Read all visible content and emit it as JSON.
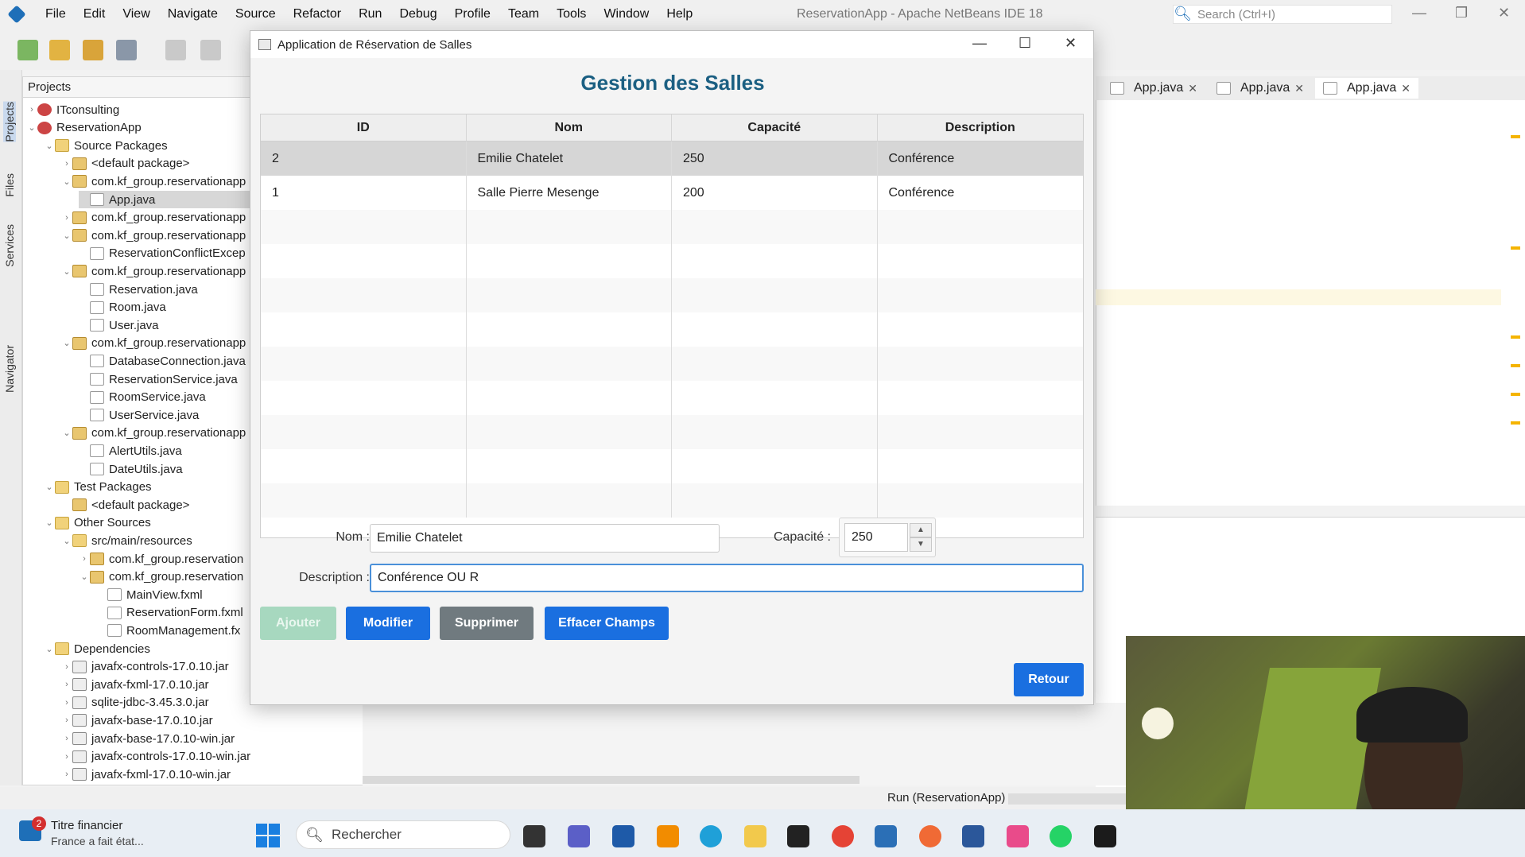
{
  "ide": {
    "title": "ReservationApp - Apache NetBeans IDE 18",
    "menu": [
      "File",
      "Edit",
      "View",
      "Navigate",
      "Source",
      "Refactor",
      "Run",
      "Debug",
      "Profile",
      "Team",
      "Tools",
      "Window",
      "Help"
    ],
    "search_placeholder": "Search (Ctrl+I)",
    "side_tabs": [
      "Projects",
      "Files",
      "Services",
      "Navigator"
    ],
    "projects_title": "Projects",
    "editor_tabs": [
      "App.java",
      "App.java",
      "App.java"
    ],
    "status_run": "Run (ReservationApp)"
  },
  "tree": [
    {
      "label": "ITconsulting",
      "indent": 0,
      "arrow": "›",
      "icon": "proj"
    },
    {
      "label": "ReservationApp",
      "indent": 0,
      "arrow": "⌄",
      "icon": "proj"
    },
    {
      "label": "Source Packages",
      "indent": 1,
      "arrow": "⌄",
      "icon": "folder"
    },
    {
      "label": "<default package>",
      "indent": 2,
      "arrow": "›",
      "icon": "pkg"
    },
    {
      "label": "com.kf_group.reservationapp",
      "indent": 2,
      "arrow": "⌄",
      "icon": "pkg"
    },
    {
      "label": "App.java",
      "indent": 3,
      "arrow": "",
      "icon": "file",
      "selected": true
    },
    {
      "label": "com.kf_group.reservationapp",
      "indent": 2,
      "arrow": "›",
      "icon": "pkg"
    },
    {
      "label": "com.kf_group.reservationapp",
      "indent": 2,
      "arrow": "⌄",
      "icon": "pkg"
    },
    {
      "label": "ReservationConflictExcep",
      "indent": 3,
      "arrow": "",
      "icon": "file"
    },
    {
      "label": "com.kf_group.reservationapp",
      "indent": 2,
      "arrow": "⌄",
      "icon": "pkg"
    },
    {
      "label": "Reservation.java",
      "indent": 3,
      "arrow": "",
      "icon": "file"
    },
    {
      "label": "Room.java",
      "indent": 3,
      "arrow": "",
      "icon": "file"
    },
    {
      "label": "User.java",
      "indent": 3,
      "arrow": "",
      "icon": "file"
    },
    {
      "label": "com.kf_group.reservationapp",
      "indent": 2,
      "arrow": "⌄",
      "icon": "pkg"
    },
    {
      "label": "DatabaseConnection.java",
      "indent": 3,
      "arrow": "",
      "icon": "file"
    },
    {
      "label": "ReservationService.java",
      "indent": 3,
      "arrow": "",
      "icon": "file"
    },
    {
      "label": "RoomService.java",
      "indent": 3,
      "arrow": "",
      "icon": "file"
    },
    {
      "label": "UserService.java",
      "indent": 3,
      "arrow": "",
      "icon": "file"
    },
    {
      "label": "com.kf_group.reservationapp",
      "indent": 2,
      "arrow": "⌄",
      "icon": "pkg"
    },
    {
      "label": "AlertUtils.java",
      "indent": 3,
      "arrow": "",
      "icon": "file"
    },
    {
      "label": "DateUtils.java",
      "indent": 3,
      "arrow": "",
      "icon": "file"
    },
    {
      "label": "Test Packages",
      "indent": 1,
      "arrow": "⌄",
      "icon": "folder"
    },
    {
      "label": "<default package>",
      "indent": 2,
      "arrow": "",
      "icon": "pkg"
    },
    {
      "label": "Other Sources",
      "indent": 1,
      "arrow": "⌄",
      "icon": "folder"
    },
    {
      "label": "src/main/resources",
      "indent": 2,
      "arrow": "⌄",
      "icon": "folder"
    },
    {
      "label": "com.kf_group.reservation",
      "indent": 3,
      "arrow": "›",
      "icon": "pkg"
    },
    {
      "label": "com.kf_group.reservation",
      "indent": 3,
      "arrow": "⌄",
      "icon": "pkg"
    },
    {
      "label": "MainView.fxml",
      "indent": 4,
      "arrow": "",
      "icon": "file"
    },
    {
      "label": "ReservationForm.fxml",
      "indent": 4,
      "arrow": "",
      "icon": "file"
    },
    {
      "label": "RoomManagement.fx",
      "indent": 4,
      "arrow": "",
      "icon": "file"
    },
    {
      "label": "Dependencies",
      "indent": 1,
      "arrow": "⌄",
      "icon": "folder"
    },
    {
      "label": "javafx-controls-17.0.10.jar",
      "indent": 2,
      "arrow": "›",
      "icon": "jar"
    },
    {
      "label": "javafx-fxml-17.0.10.jar",
      "indent": 2,
      "arrow": "›",
      "icon": "jar"
    },
    {
      "label": "sqlite-jdbc-3.45.3.0.jar",
      "indent": 2,
      "arrow": "›",
      "icon": "jar"
    },
    {
      "label": "javafx-base-17.0.10.jar",
      "indent": 2,
      "arrow": "›",
      "icon": "jar"
    },
    {
      "label": "javafx-base-17.0.10-win.jar",
      "indent": 2,
      "arrow": "›",
      "icon": "jar"
    },
    {
      "label": "javafx-controls-17.0.10-win.jar",
      "indent": 2,
      "arrow": "›",
      "icon": "jar"
    },
    {
      "label": "javafx-fxml-17.0.10-win.jar",
      "indent": 2,
      "arrow": "›",
      "icon": "jar"
    }
  ],
  "app": {
    "window_title": "Application de Réservation de Salles",
    "heading": "Gestion des Salles",
    "columns": [
      "ID",
      "Nom",
      "Capacité",
      "Description"
    ],
    "rows": [
      [
        "2",
        "Emilie Chatelet",
        "250",
        "Conférence"
      ],
      [
        "1",
        "Salle Pierre Mesenge",
        "200",
        "Conférence"
      ]
    ],
    "form": {
      "nom_label": "Nom :",
      "nom_value": "Emilie Chatelet",
      "capacite_label": "Capacité :",
      "capacite_value": "250",
      "description_label": "Description :",
      "description_value": "Conférence OU R"
    },
    "buttons": {
      "add": "Ajouter",
      "modify": "Modifier",
      "delete": "Supprimer",
      "clear": "Effacer Champs",
      "back": "Retour"
    }
  },
  "taskbar": {
    "notif_badge": "2",
    "notif_title": "Titre financier",
    "notif_sub": "France a fait état...",
    "search": "Rechercher"
  },
  "colors": {
    "primary_button": "#1a6fe0",
    "heading": "#1b5f82",
    "disabled_button": "#a7d8bf",
    "delete_button": "#707a7f"
  }
}
